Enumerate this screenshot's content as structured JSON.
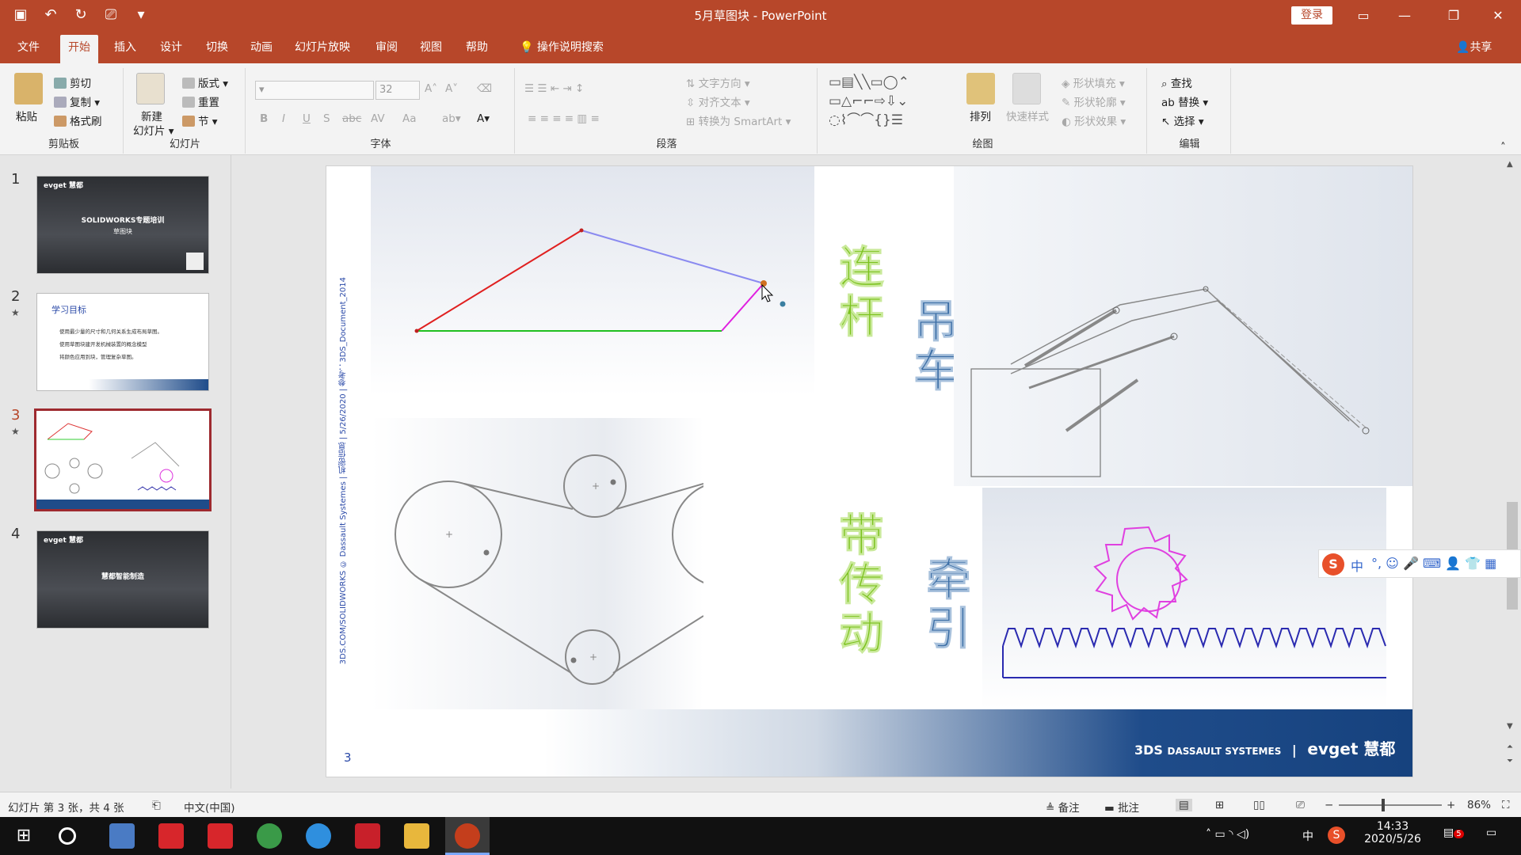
{
  "window": {
    "title": "5月草图块 - PowerPoint",
    "login": "登录",
    "share": "共享"
  },
  "tabs": [
    "文件",
    "开始",
    "插入",
    "设计",
    "切换",
    "动画",
    "幻灯片放映",
    "审阅",
    "视图",
    "帮助"
  ],
  "active_tab": "开始",
  "tell_me": "操作说明搜索",
  "ribbon": {
    "clipboard": {
      "paste": "粘贴",
      "cut": "剪切",
      "copy": "复制",
      "format_painter": "格式刷",
      "label": "剪贴板"
    },
    "slides": {
      "new_slide": "新建",
      "new_slide2": "幻灯片",
      "layout": "版式",
      "reset": "重置",
      "section": "节",
      "label": "幻灯片"
    },
    "font": {
      "size": "32",
      "label": "字体",
      "bold": "B",
      "italic": "I",
      "underline": "U",
      "shadow": "S",
      "strike": "abc",
      "spacing": "AV",
      "case": "Aa"
    },
    "paragraph": {
      "text_direction": "文字方向",
      "align_text": "对齐文本",
      "smartart": "转换为 SmartArt",
      "label": "段落"
    },
    "drawing": {
      "arrange": "排列",
      "quick_styles": "快速样式",
      "shape_fill": "形状填充",
      "shape_outline": "形状轮廓",
      "shape_effects": "形状效果",
      "label": "绘图"
    },
    "editing": {
      "find": "查找",
      "replace": "替换",
      "select": "选择",
      "label": "编辑"
    }
  },
  "thumbnails": [
    {
      "num": "1",
      "title": "SOLIDWORKS专题培训",
      "sub": "草图块",
      "logo": "evget 慧都"
    },
    {
      "num": "2",
      "title": "学习目标",
      "lines": [
        "使用最少量的尺寸和几何关系生成布局草图。",
        "使用草图块建开发机械装置的概念模型",
        "将颜色应用到块，管理复杂草图。"
      ]
    },
    {
      "num": "3"
    },
    {
      "num": "4",
      "title": "慧都智能制造",
      "logo": "evget 慧都"
    }
  ],
  "slide": {
    "labels": {
      "linkage": "连杆",
      "crane": "吊车",
      "belt": "带传动",
      "traction": "牵引"
    },
    "side_text": "3DS.COM/SOLIDWORKS © Dassault Systemes | 机密信息 | 5/26/2020 | 参考：3DS_Document_2014",
    "page_number": "3",
    "brand_left": "DASSAULT SYSTEMES",
    "brand_right": "evget 慧都"
  },
  "status": {
    "slide_info": "幻灯片 第 3 张，共 4 张",
    "language": "中文(中国)",
    "notes": "备注",
    "comments": "批注",
    "zoom": "86%"
  },
  "ime": {
    "mode": "中"
  },
  "clock": {
    "time": "14:33",
    "date": "2020/5/26",
    "tray_lang": "中",
    "notif": "5"
  },
  "colors": {
    "accent": "#b7472a",
    "green_label": "#7cc21f",
    "blue_label": "#3d6fa6",
    "footer_blue": "#16427e"
  }
}
